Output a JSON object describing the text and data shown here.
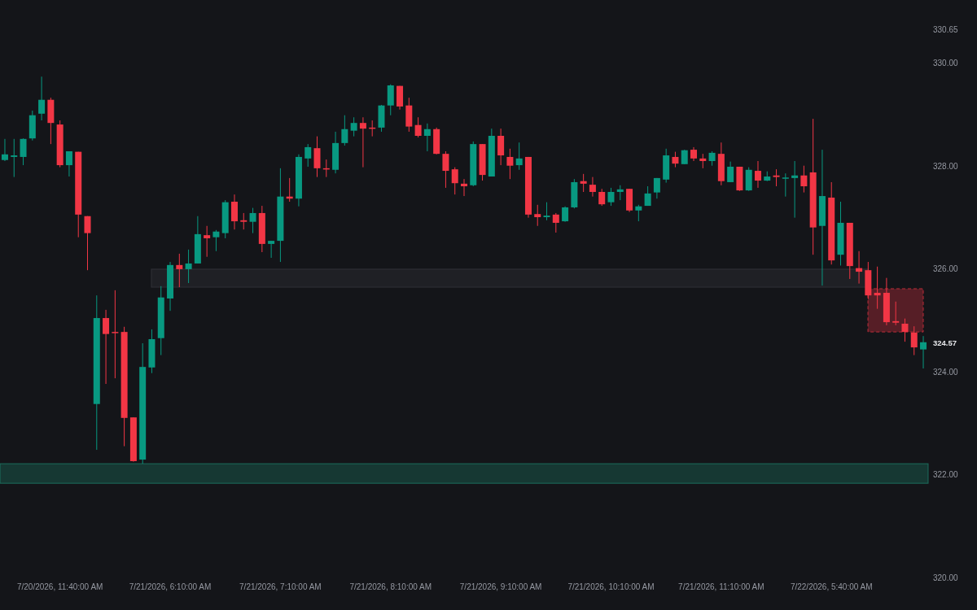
{
  "chart_data": {
    "type": "candlestick",
    "ylim": [
      320,
      330.65
    ],
    "yticks": [
      {
        "value": 320,
        "label": "320.00"
      },
      {
        "value": 322,
        "label": "322.00"
      },
      {
        "value": 324,
        "label": "324.00"
      },
      {
        "value": 326,
        "label": "326.00"
      },
      {
        "value": 328,
        "label": "328.00"
      },
      {
        "value": 330,
        "label": "330.00"
      },
      {
        "value": 330.65,
        "label": "330.65"
      }
    ],
    "categories": [
      null,
      null,
      null,
      null,
      null,
      null,
      "7/20/2026, 11:40:00 AM",
      null,
      null,
      null,
      null,
      null,
      null,
      null,
      null,
      null,
      null,
      null,
      "7/21/2026, 6:10:00 AM",
      null,
      null,
      null,
      null,
      null,
      null,
      null,
      null,
      null,
      null,
      null,
      "7/21/2026, 7:10:00 AM",
      null,
      null,
      null,
      null,
      null,
      null,
      null,
      null,
      null,
      null,
      null,
      "7/21/2026, 8:10:00 AM",
      null,
      null,
      null,
      null,
      null,
      null,
      null,
      null,
      null,
      null,
      null,
      "7/21/2026, 9:10:00 AM",
      null,
      null,
      null,
      null,
      null,
      null,
      null,
      null,
      null,
      null,
      null,
      "7/21/2026, 10:10:00 AM",
      null,
      null,
      null,
      null,
      null,
      null,
      null,
      null,
      null,
      null,
      null,
      "7/21/2026, 11:10:00 AM",
      null,
      null,
      null,
      null,
      null,
      null,
      null,
      null,
      null,
      null,
      null,
      "7/22/2026, 5:40:00 AM",
      null,
      null,
      null,
      null,
      null,
      null,
      null,
      null,
      null,
      null
    ],
    "ohlc": [
      [
        328.11,
        328.52,
        328.09,
        328.22
      ],
      [
        328.17,
        328.52,
        327.78,
        328.2
      ],
      [
        328.17,
        328.53,
        328.01,
        328.52
      ],
      [
        328.53,
        329.07,
        328.49,
        328.98
      ],
      [
        329.01,
        329.73,
        328.88,
        329.28
      ],
      [
        329.28,
        329.32,
        328.42,
        328.83
      ],
      [
        328.8,
        328.88,
        327.97,
        328.01
      ],
      [
        328.01,
        328.28,
        327.79,
        328.28
      ],
      [
        328.27,
        328.27,
        326.61,
        327.05
      ],
      [
        327.02,
        327.02,
        325.97,
        326.69
      ],
      [
        323.37,
        325.48,
        322.48,
        325.04
      ],
      [
        325.04,
        325.2,
        323.76,
        324.73
      ],
      [
        324.77,
        325.58,
        323.87,
        324.76
      ],
      [
        324.77,
        324.87,
        322.55,
        323.1
      ],
      [
        323.11,
        323.11,
        322.25,
        322.26
      ],
      [
        322.29,
        324.55,
        322.21,
        324.09
      ],
      [
        324.08,
        324.82,
        323.97,
        324.63
      ],
      [
        324.65,
        325.66,
        324.32,
        325.44
      ],
      [
        325.42,
        326.13,
        325.18,
        326.07
      ],
      [
        326.07,
        326.29,
        325.64,
        325.99
      ],
      [
        325.99,
        326.37,
        325.72,
        326.1
      ],
      [
        326.1,
        327.02,
        326.1,
        326.67
      ],
      [
        326.65,
        326.83,
        326.23,
        326.59
      ],
      [
        326.61,
        326.75,
        326.34,
        326.72
      ],
      [
        326.69,
        327.33,
        326.59,
        327.29
      ],
      [
        327.3,
        327.44,
        326.76,
        326.92
      ],
      [
        326.94,
        327.08,
        326.76,
        326.91
      ],
      [
        326.91,
        327.18,
        326.69,
        327.08
      ],
      [
        327.08,
        327.22,
        326.32,
        326.48
      ],
      [
        326.48,
        326.54,
        326.21,
        326.54
      ],
      [
        326.54,
        327.95,
        326.13,
        327.4
      ],
      [
        327.4,
        327.76,
        327.3,
        327.36
      ],
      [
        327.36,
        328.22,
        327.21,
        328.17
      ],
      [
        328.14,
        328.42,
        327.98,
        328.36
      ],
      [
        328.34,
        328.57,
        327.78,
        327.95
      ],
      [
        327.95,
        328.12,
        327.78,
        327.93
      ],
      [
        327.92,
        328.66,
        327.85,
        328.44
      ],
      [
        328.44,
        328.98,
        328.39,
        328.71
      ],
      [
        328.68,
        328.94,
        328.57,
        328.83
      ],
      [
        328.83,
        328.94,
        327.97,
        328.72
      ],
      [
        328.74,
        328.88,
        328.57,
        328.73
      ],
      [
        328.74,
        329.18,
        328.66,
        329.17
      ],
      [
        329.17,
        329.58,
        328.98,
        329.56
      ],
      [
        329.55,
        329.55,
        329.09,
        329.15
      ],
      [
        329.17,
        329.32,
        328.66,
        328.76
      ],
      [
        328.79,
        328.94,
        328.55,
        328.58
      ],
      [
        328.58,
        328.82,
        328.28,
        328.71
      ],
      [
        328.71,
        328.74,
        328.22,
        328.23
      ],
      [
        328.23,
        328.28,
        327.57,
        327.9
      ],
      [
        327.93,
        327.97,
        327.44,
        327.66
      ],
      [
        327.65,
        327.74,
        327.41,
        327.6
      ],
      [
        327.62,
        328.47,
        327.6,
        328.42
      ],
      [
        328.42,
        328.42,
        327.71,
        327.82
      ],
      [
        327.79,
        328.72,
        327.79,
        328.58
      ],
      [
        328.58,
        328.72,
        328.01,
        328.2
      ],
      [
        328.17,
        328.33,
        327.74,
        328.0
      ],
      [
        328.01,
        328.45,
        327.92,
        328.14
      ],
      [
        328.17,
        328.17,
        326.99,
        327.05
      ],
      [
        327.06,
        327.24,
        326.83,
        327.0
      ],
      [
        327.0,
        327.29,
        326.94,
        327.03
      ],
      [
        327.05,
        327.08,
        326.7,
        326.89
      ],
      [
        326.92,
        327.21,
        326.91,
        327.19
      ],
      [
        327.19,
        327.74,
        327.17,
        327.68
      ],
      [
        327.7,
        327.84,
        327.49,
        327.65
      ],
      [
        327.63,
        327.78,
        327.4,
        327.49
      ],
      [
        327.49,
        327.55,
        327.22,
        327.25
      ],
      [
        327.29,
        327.57,
        327.22,
        327.49
      ],
      [
        327.49,
        327.62,
        327.33,
        327.54
      ],
      [
        327.55,
        327.55,
        327.1,
        327.13
      ],
      [
        327.13,
        327.24,
        326.92,
        327.21
      ],
      [
        327.22,
        327.6,
        327.22,
        327.46
      ],
      [
        327.48,
        327.76,
        327.36,
        327.76
      ],
      [
        327.73,
        328.33,
        327.67,
        328.2
      ],
      [
        328.17,
        328.27,
        327.97,
        328.04
      ],
      [
        328.03,
        328.31,
        328.03,
        328.3
      ],
      [
        328.31,
        328.36,
        328.09,
        328.14
      ],
      [
        328.14,
        328.23,
        327.95,
        328.09
      ],
      [
        328.09,
        328.28,
        328.0,
        328.25
      ],
      [
        328.23,
        328.45,
        327.62,
        327.7
      ],
      [
        327.68,
        328.08,
        327.68,
        327.98
      ],
      [
        327.98,
        327.98,
        327.51,
        327.52
      ],
      [
        327.52,
        327.97,
        327.51,
        327.92
      ],
      [
        327.9,
        328.09,
        327.57,
        327.71
      ],
      [
        327.71,
        327.89,
        327.7,
        327.79
      ],
      [
        327.81,
        327.93,
        327.6,
        327.78
      ],
      [
        327.76,
        327.85,
        327.4,
        327.77
      ],
      [
        327.76,
        328.09,
        326.99,
        327.81
      ],
      [
        327.81,
        328.0,
        327.48,
        327.6
      ],
      [
        327.87,
        328.91,
        326.27,
        326.8
      ],
      [
        326.83,
        328.31,
        325.67,
        327.41
      ],
      [
        327.38,
        327.68,
        326.08,
        326.16
      ],
      [
        326.27,
        327.3,
        326.06,
        326.89
      ],
      [
        326.89,
        326.89,
        325.8,
        326.05
      ],
      [
        326.01,
        326.34,
        325.71,
        325.94
      ],
      [
        325.97,
        326.13,
        325.41,
        325.48
      ],
      [
        325.53,
        326.04,
        325.22,
        325.48
      ],
      [
        325.53,
        325.82,
        324.9,
        324.96
      ],
      [
        324.98,
        325.36,
        324.9,
        324.95
      ],
      [
        324.93,
        325.03,
        324.58,
        324.77
      ],
      [
        324.76,
        324.88,
        324.32,
        324.47
      ],
      [
        324.43,
        324.69,
        324.06,
        324.57
      ]
    ],
    "bands": [
      {
        "axis": "y",
        "from": 325.64,
        "to": 325.99,
        "color": "#3a3b41"
      },
      {
        "axis": "y",
        "from": 324.77,
        "to": 325.61,
        "color": "#f23645"
      },
      {
        "axis": "y",
        "from": 321.83,
        "to": 322.21,
        "color": "#1f8a72"
      }
    ],
    "annotations": [
      "324.57"
    ]
  }
}
